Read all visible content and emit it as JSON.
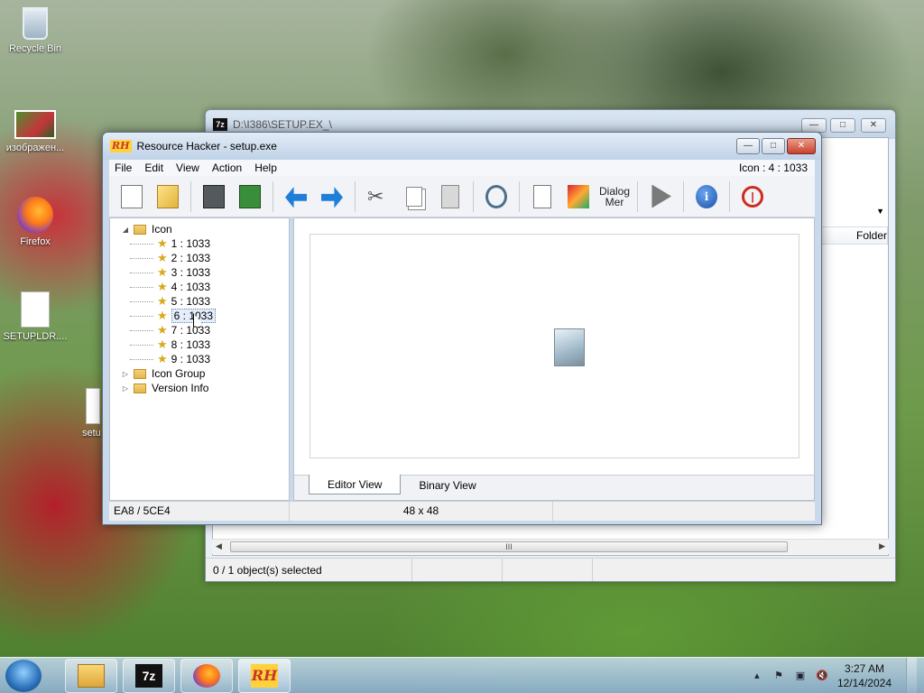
{
  "desktop": {
    "icons": [
      {
        "label": "Recycle Bin"
      },
      {
        "label": "изображен..."
      },
      {
        "label": "Firefox"
      },
      {
        "label": "SETUPLDR...."
      },
      {
        "label": "setu"
      }
    ]
  },
  "sevenzip": {
    "title": "D:\\I386\\SETUP.EX_\\",
    "column_header": "Folder",
    "status": "0 / 1 object(s) selected",
    "scroll_thumb": "III"
  },
  "rh": {
    "title": "Resource Hacker - setup.exe",
    "menu": [
      "File",
      "Edit",
      "View",
      "Action",
      "Help"
    ],
    "menu_info": "Icon : 4 : 1033",
    "toolbar": {
      "dialog_line1": "Dialog",
      "dialog_line2": "Mer"
    },
    "tree": {
      "root": "Icon",
      "children": [
        "1 : 1033",
        "2 : 1033",
        "3 : 1033",
        "4 : 1033",
        "5 : 1033",
        "6 : 1033",
        "7 : 1033",
        "8 : 1033",
        "9 : 1033"
      ],
      "selected_index": 5,
      "others": [
        "Icon Group",
        "Version Info"
      ]
    },
    "tabs": [
      "Editor View",
      "Binary View"
    ],
    "status_left": "EA8 / 5CE4",
    "status_mid": "48 x 48"
  },
  "taskbar": {
    "time": "3:27 AM",
    "date": "12/14/2024",
    "seven_zip_label": "7z",
    "rh_label": "RH"
  }
}
